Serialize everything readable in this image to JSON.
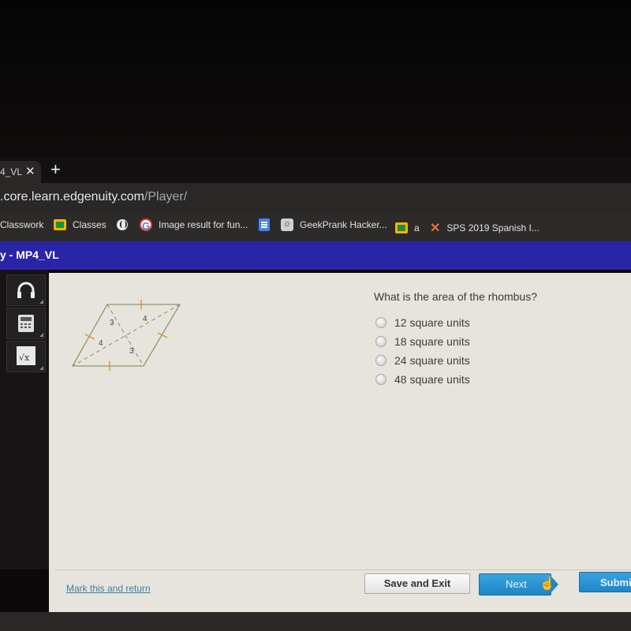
{
  "browser": {
    "tab": {
      "title": "4_VL",
      "close_glyph": "✕"
    },
    "new_tab_glyph": "+",
    "url": {
      "host": ".core.learn.edgenuity.com",
      "path": "/Player/"
    },
    "bookmarks": [
      {
        "label": "Classwork",
        "icon": "none"
      },
      {
        "label": "Classes",
        "icon": "google-classroom-icon"
      },
      {
        "label": "",
        "icon": "globe-icon"
      },
      {
        "label": "Image result for fun...",
        "icon": "google-icon"
      },
      {
        "label": "",
        "icon": "google-docs-icon"
      },
      {
        "label": "GeekPrank Hacker...",
        "icon": "troll-face-icon"
      },
      {
        "label": "a",
        "icon": "google-classroom-icon"
      },
      {
        "label": "SPS 2019 Spanish I...",
        "icon": "x-logo-icon"
      }
    ]
  },
  "app": {
    "header_title": "y - MP4_VL",
    "tools": [
      {
        "name": "headphones-icon"
      },
      {
        "name": "calculator-icon"
      },
      {
        "name": "formula-sqrt-icon",
        "glyph": "√x"
      }
    ],
    "colors": {
      "header": "#2a25a6",
      "next": "#2a95d6",
      "link": "#3a7fa6",
      "tick": "#e0902a"
    }
  },
  "diagram": {
    "shape": "rhombus",
    "segment_labels": [
      "3",
      "4",
      "4",
      "3"
    ]
  },
  "question": {
    "prompt": "What is the area of the rhombus?",
    "options": [
      {
        "label": "12 square units",
        "selected": false
      },
      {
        "label": "18 square units",
        "selected": false
      },
      {
        "label": "24 square units",
        "selected": false
      },
      {
        "label": "48 square units",
        "selected": false
      }
    ]
  },
  "footer": {
    "mark_link": "Mark this and return",
    "save_exit": "Save and Exit",
    "next": "Next",
    "submit": "Submit"
  }
}
